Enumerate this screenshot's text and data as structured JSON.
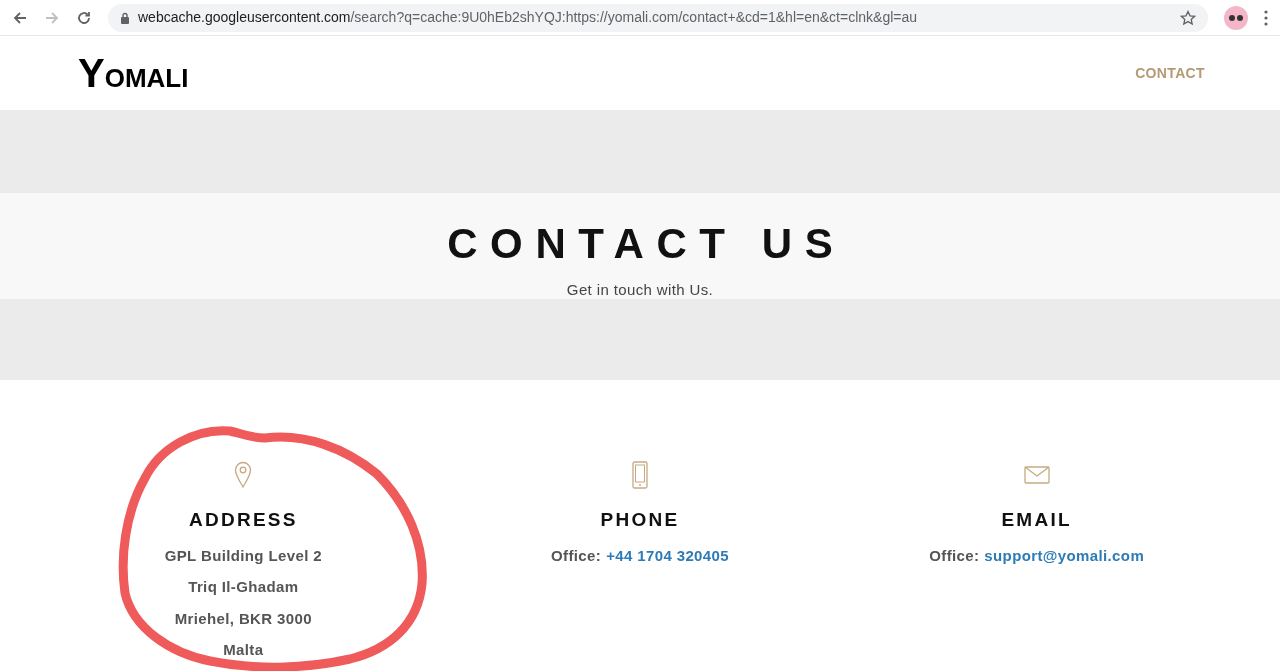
{
  "browser": {
    "url_host": "webcache.googleusercontent.com",
    "url_rest": "/search?q=cache:9U0hEb2shYQJ:https://yomali.com/contact+&cd=1&hl=en&ct=clnk&gl=au"
  },
  "header": {
    "logo_initial": "Y",
    "logo_rest": "OMALI",
    "nav": [
      {
        "label": "CONTACT"
      }
    ]
  },
  "hero": {
    "title": "CONTACT US",
    "subtitle": "Get in touch with Us."
  },
  "contacts": [
    {
      "kind": "address",
      "heading": "ADDRESS",
      "lines": [
        "GPL Building Level 2",
        "Triq Il-Ghadam",
        "Mriehel, BKR 3000",
        "Malta"
      ]
    },
    {
      "kind": "phone",
      "heading": "PHONE",
      "label": "Office:",
      "link": "+44 1704 320405"
    },
    {
      "kind": "email",
      "heading": "EMAIL",
      "label": "Office:",
      "link": "support@yomali.com"
    }
  ]
}
